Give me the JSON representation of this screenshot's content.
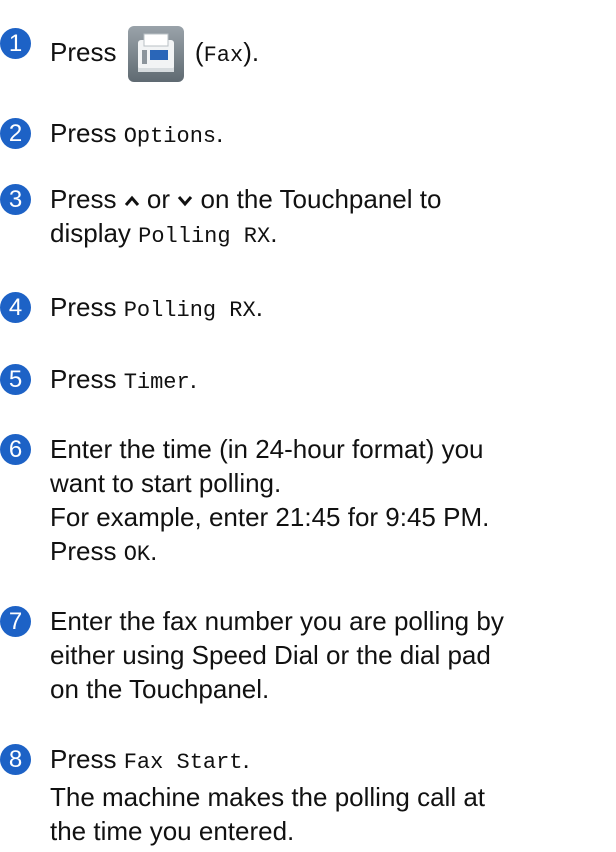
{
  "steps": [
    {
      "number": "1",
      "parts": {
        "a": "Press ",
        "b": " (",
        "c": "Fax",
        "d": ")."
      }
    },
    {
      "number": "2",
      "parts": {
        "a": "Press ",
        "b": "Options",
        "c": "."
      }
    },
    {
      "number": "3",
      "line1": {
        "a": "Press ",
        "b": " or ",
        "c": " on the Touchpanel to"
      },
      "line2": {
        "a": "display ",
        "b": "Polling RX",
        "c": "."
      }
    },
    {
      "number": "4",
      "parts": {
        "a": "Press ",
        "b": "Polling RX",
        "c": "."
      }
    },
    {
      "number": "5",
      "parts": {
        "a": "Press ",
        "b": "Timer",
        "c": "."
      }
    },
    {
      "number": "6",
      "line1": "Enter the time (in 24-hour format) you",
      "line2": "want to start polling.",
      "line3": "For example, enter 21:45 for 9:45 PM.",
      "line4": {
        "a": "Press ",
        "b": "OK",
        "c": "."
      }
    },
    {
      "number": "7",
      "line1": "Enter the fax number you are polling by",
      "line2": "either using Speed Dial or the dial pad",
      "line3": "on the Touchpanel."
    },
    {
      "number": "8",
      "line1": {
        "a": "Press ",
        "b": "Fax Start",
        "c": "."
      },
      "line2": "The machine makes the polling call at",
      "line3": "the time you entered."
    }
  ],
  "icons": {
    "fax": "fax-icon",
    "up": "chevron-up-icon",
    "down": "chevron-down-icon"
  },
  "colors": {
    "step_badge": "#1d62c6"
  }
}
